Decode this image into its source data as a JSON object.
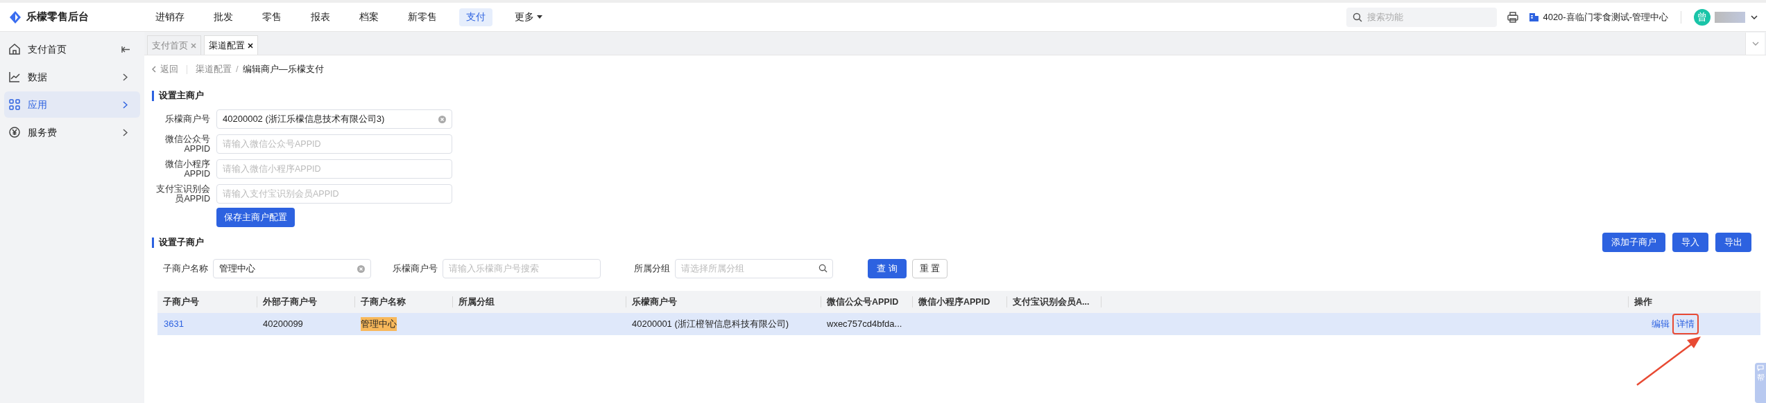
{
  "app": {
    "title": "乐檬零售后台"
  },
  "nav": [
    {
      "label": "进销存",
      "selected": false,
      "dropdown": false
    },
    {
      "label": "批发",
      "selected": false,
      "dropdown": false
    },
    {
      "label": "零售",
      "selected": false,
      "dropdown": false
    },
    {
      "label": "报表",
      "selected": false,
      "dropdown": false
    },
    {
      "label": "档案",
      "selected": false,
      "dropdown": false
    },
    {
      "label": "新零售",
      "selected": false,
      "dropdown": false
    },
    {
      "label": "支付",
      "selected": true,
      "dropdown": false
    },
    {
      "label": "更多",
      "selected": false,
      "dropdown": true
    }
  ],
  "search": {
    "placeholder": "搜索功能"
  },
  "store": "4020-喜临门零食测试-管理中心",
  "avatar": "曾",
  "sidebar": [
    {
      "label": "支付首页",
      "kind": "home",
      "selected": false,
      "collapse": true
    },
    {
      "label": "数据",
      "kind": "chart",
      "selected": false,
      "collapse": false
    },
    {
      "label": "应用",
      "kind": "grid",
      "selected": true,
      "collapse": false
    },
    {
      "label": "服务费",
      "kind": "yen",
      "selected": false,
      "collapse": false
    }
  ],
  "tabs": [
    {
      "label": "支付首页",
      "selected": false
    },
    {
      "label": "渠道配置",
      "selected": true
    }
  ],
  "breadcrumb": {
    "back": "返回",
    "items": [
      "渠道配置",
      "编辑商户—乐檬支付"
    ],
    "separator": "/"
  },
  "main_section": {
    "title": "设置主商户",
    "fields": [
      {
        "label": "乐檬商户号",
        "value": "40200002 (浙江乐檬信息技术有限公司3)",
        "clearable": true
      },
      {
        "label": "微信公众号APPID",
        "placeholder": "请输入微信公众号APPID",
        "clearable": false
      },
      {
        "label": "微信小程序APPID",
        "placeholder": "请输入微信小程序APPID",
        "clearable": false
      },
      {
        "label": "支付宝识别会员APPID",
        "placeholder": "请输入支付宝识别会员APPID",
        "clearable": false
      }
    ],
    "save_button": "保存主商户配置"
  },
  "sub_section": {
    "title": "设置子商户",
    "actions": [
      "添加子商户",
      "导入",
      "导出"
    ],
    "filters": [
      {
        "label": "子商户名称",
        "value": "管理中心",
        "kind": "clear"
      },
      {
        "label": "乐檬商户号",
        "placeholder": "请输入乐檬商户号搜索",
        "kind": "plain"
      },
      {
        "label": "所属分组",
        "placeholder": "请选择所属分组",
        "kind": "search"
      }
    ],
    "query_button": "查 询",
    "reset_button": "重 置"
  },
  "table": {
    "columns": [
      "子商户号",
      "外部子商户号",
      "子商户名称",
      "所属分组",
      "乐檬商户号",
      "微信公众号APPID",
      "微信小程序APPID",
      "支付宝识别会员A...",
      "操作"
    ],
    "rows": [
      {
        "selected": true,
        "merchant_id": "3631",
        "external_id": "40200099",
        "name": "管理中心",
        "name_highlighted": true,
        "lemeng_merchant": "40200001 (浙江橙智信息科技有限公司)",
        "wechat_appid": "wxec757cd4bfda...",
        "actions": [
          {
            "label": "编辑",
            "annotated": false
          },
          {
            "label": "详情",
            "annotated": true
          }
        ]
      }
    ]
  },
  "help_tab": "帮"
}
